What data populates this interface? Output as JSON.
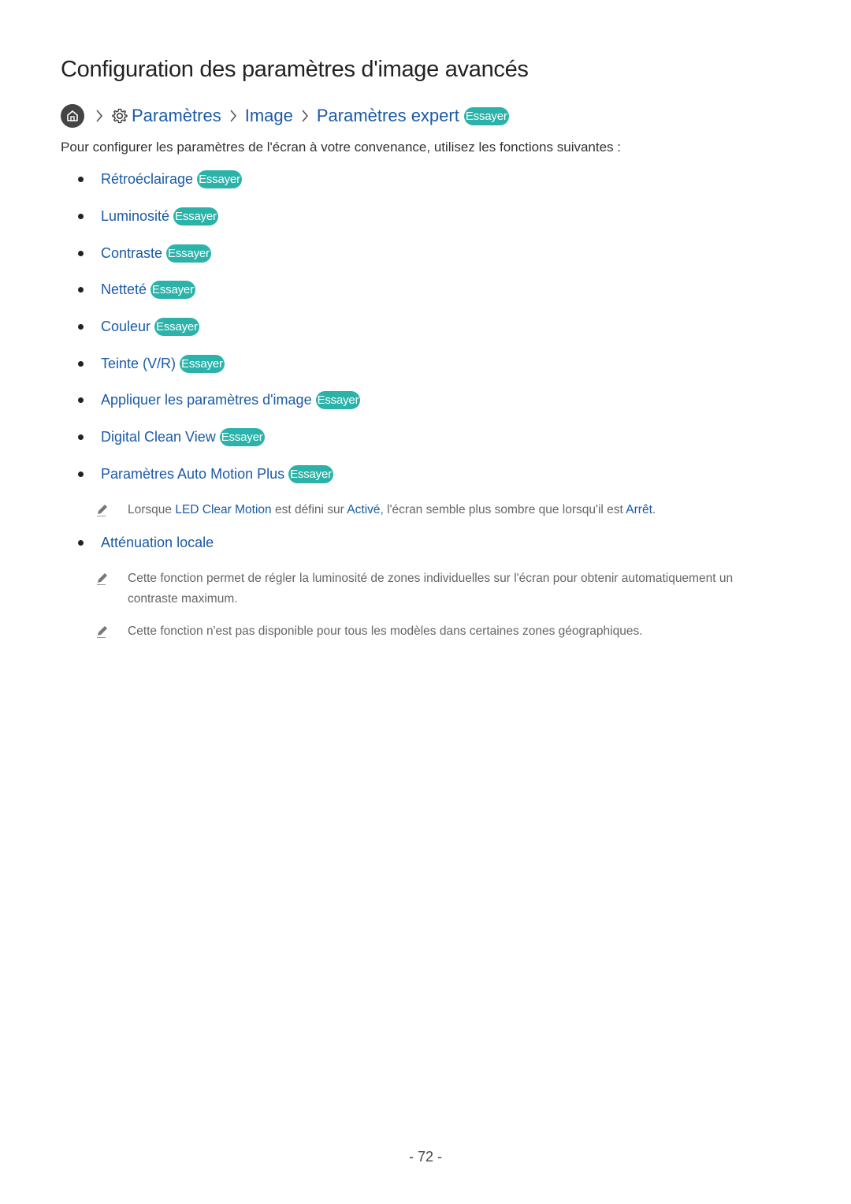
{
  "page": {
    "title": "Configuration des paramètres d'image avancés",
    "page_number": "- 72 -"
  },
  "breadcrumb": {
    "home_icon": "home-icon",
    "settings_icon": "gear-icon",
    "items": [
      "Paramètres",
      "Image",
      "Paramètres expert"
    ],
    "badge": "Essayer"
  },
  "intro": "Pour configurer les paramètres de l'écran à votre convenance, utilisez les fonctions suivantes :",
  "colors": {
    "link": "#1a5aa6",
    "badge": "#2bb3aa"
  },
  "items": [
    {
      "label": "Rétroéclairage",
      "badge": "Essayer"
    },
    {
      "label": "Luminosité",
      "badge": "Essayer"
    },
    {
      "label": "Contraste",
      "badge": "Essayer"
    },
    {
      "label": "Netteté",
      "badge": "Essayer"
    },
    {
      "label": "Couleur",
      "badge": "Essayer"
    },
    {
      "label": "Teinte (V/R)",
      "badge": "Essayer"
    },
    {
      "label": "Appliquer les paramètres d'image",
      "badge": "Essayer"
    },
    {
      "label": "Digital Clean View",
      "badge": "Essayer"
    },
    {
      "label": "Paramètres Auto Motion Plus",
      "badge": "Essayer"
    },
    {
      "label": "Atténuation locale"
    }
  ],
  "notes": {
    "motion": {
      "p1": "Lorsque ",
      "hl1": "LED Clear Motion",
      "p2": " est défini sur ",
      "hl2": "Activé",
      "p3": ", l'écran semble plus sombre que lorsqu'il est ",
      "hl3": "Arrêt",
      "p4": "."
    },
    "local_dimming_1": "Cette fonction permet de régler la luminosité de zones individuelles sur l'écran pour obtenir automatiquement un contraste maximum.",
    "local_dimming_2": "Cette fonction n'est pas disponible pour tous les modèles dans certaines zones géographiques."
  }
}
